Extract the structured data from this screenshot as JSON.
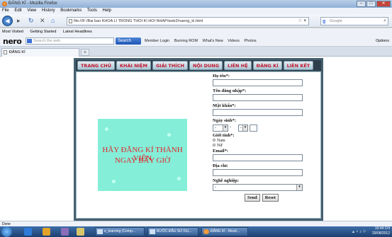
{
  "window": {
    "title": "ĐĂNG KÍ - Mozilla Firefox",
    "buttons": [
      "–",
      "□",
      "✕"
    ]
  },
  "menubar": [
    "File",
    "Edit",
    "View",
    "History",
    "Bookmarks",
    "Tools",
    "Help"
  ],
  "navigation": {
    "url": "file:///F:/Bai bao KHOA LI TRONG THOI KI HOI NHAP/web2/naeng_ki.html",
    "search_engine": "Google"
  },
  "bookmarks": [
    "Most Visited",
    "Getting Started",
    "Latest Headlines"
  ],
  "nero": {
    "brand": "nero",
    "search_placeholder": "Search the web",
    "search_button": "Search",
    "links": [
      "Member Login",
      "Burning ROM",
      "What's New",
      "Videos",
      "Photos"
    ],
    "options": "Options"
  },
  "tab": {
    "label": "ĐĂNG KÍ",
    "newtab": "+"
  },
  "site_menu": [
    "TRANG CHỦ",
    "KHÁI NIỆM",
    "GIẢI THÍCH",
    "NỘI DUNG",
    "LIÊN HỆ",
    "ĐĂNG KÍ",
    "LIÊN KẾT"
  ],
  "banner": {
    "line1": "HÃY ĐĂNG KÍ THÀNH VIÊN",
    "line2": "NGAY BÂY GIỜ"
  },
  "form": {
    "hoten": "Họ tên*:",
    "tendangnhap": "Tên đăng nhập*:",
    "matkhau": "Mật khẩu*:",
    "ngaysinh": "Ngày sinh*:",
    "dob_day": "-",
    "dob_month": "-",
    "dob_sep": "-",
    "gioitinh": "Giới tính*:",
    "nam": "Nam",
    "nu": "Nữ",
    "email": "Email*:",
    "diachi": "Địa chỉ:",
    "nghenghiep": "Nghề nghiệp:",
    "nghenghiep_value": "-",
    "send": "Send",
    "reset": "Reset"
  },
  "status": "Done",
  "taskbar": {
    "items": [
      "e_learning (Comp...",
      "BƯỚC ĐẦU SỬ DỤ...",
      "ĐĂNG KÍ - Mozil..."
    ],
    "time": "10:44 CH",
    "date": "29/08/2012"
  }
}
